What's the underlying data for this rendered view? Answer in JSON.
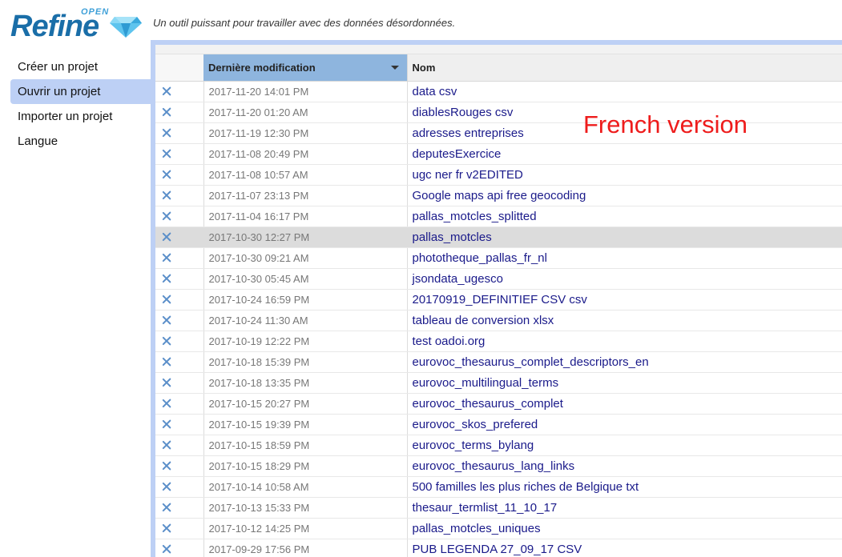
{
  "header": {
    "logo_word": "Refine",
    "logo_open": "OPEN",
    "tagline": "Un outil puissant pour travailler avec des données désordonnées."
  },
  "nav": {
    "items": [
      {
        "label": "Créer un projet"
      },
      {
        "label": "Ouvrir un projet",
        "active": true
      },
      {
        "label": "Importer un projet"
      },
      {
        "label": "Langue"
      }
    ]
  },
  "table": {
    "col_modified": "Dernière modification",
    "col_name": "Nom",
    "rows": [
      {
        "date": "2017-11-20 14:01 PM",
        "name": "data csv"
      },
      {
        "date": "2017-11-20 01:20 AM",
        "name": "diablesRouges csv"
      },
      {
        "date": "2017-11-19 12:30 PM",
        "name": "adresses entreprises"
      },
      {
        "date": "2017-11-08 20:49 PM",
        "name": "deputesExercice"
      },
      {
        "date": "2017-11-08 10:57 AM",
        "name": "ugc ner fr v2EDITED"
      },
      {
        "date": "2017-11-07 23:13 PM",
        "name": "Google maps api free geocoding"
      },
      {
        "date": "2017-11-04 16:17 PM",
        "name": "pallas_motcles_splitted"
      },
      {
        "date": "2017-10-30 12:27 PM",
        "name": "pallas_motcles",
        "highlight": true
      },
      {
        "date": "2017-10-30 09:21 AM",
        "name": "phototheque_pallas_fr_nl"
      },
      {
        "date": "2017-10-30 05:45 AM",
        "name": "jsondata_ugesco"
      },
      {
        "date": "2017-10-24 16:59 PM",
        "name": "20170919_DEFINITIEF CSV csv"
      },
      {
        "date": "2017-10-24 11:30 AM",
        "name": "tableau de conversion xlsx"
      },
      {
        "date": "2017-10-19 12:22 PM",
        "name": "test oadoi.org"
      },
      {
        "date": "2017-10-18 15:39 PM",
        "name": "eurovoc_thesaurus_complet_descriptors_en"
      },
      {
        "date": "2017-10-18 13:35 PM",
        "name": "eurovoc_multilingual_terms"
      },
      {
        "date": "2017-10-15 20:27 PM",
        "name": "eurovoc_thesaurus_complet"
      },
      {
        "date": "2017-10-15 19:39 PM",
        "name": "eurovoc_skos_prefered"
      },
      {
        "date": "2017-10-15 18:59 PM",
        "name": "eurovoc_terms_bylang"
      },
      {
        "date": "2017-10-15 18:29 PM",
        "name": "eurovoc_thesaurus_lang_links"
      },
      {
        "date": "2017-10-14 10:58 AM",
        "name": "500 familles les plus riches de Belgique txt"
      },
      {
        "date": "2017-10-13 15:33 PM",
        "name": "thesaur_termlist_11_10_17"
      },
      {
        "date": "2017-10-12 14:25 PM",
        "name": "pallas_motcles_uniques"
      },
      {
        "date": "2017-09-29 17:56 PM",
        "name": "PUB LEGENDA 27_09_17 CSV"
      }
    ]
  },
  "overlay_note": "French version",
  "colors": {
    "accent": "#bdd0f5",
    "sorted_header": "#8eb5de",
    "link": "#1a1a8a",
    "delete_icon": "#5b8fc9",
    "note": "#ee1c1c"
  }
}
